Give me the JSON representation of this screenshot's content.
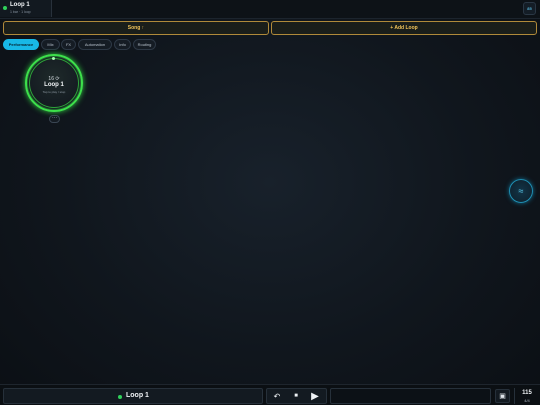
{
  "project": {
    "title": "Loop 1",
    "subtitle": "1 bar · 1 loop",
    "status_color": "#2fd15a"
  },
  "top_right_button": {
    "label": "85"
  },
  "actions": {
    "song_label": "Song ↑",
    "add_loop_label": "+ Add Loop",
    "accent_color": "#f0c35a"
  },
  "tabs": [
    {
      "label": "Performance",
      "active": true
    },
    {
      "label": "Mix",
      "active": false
    },
    {
      "label": "FX",
      "active": false
    },
    {
      "label": "Automation",
      "active": false
    },
    {
      "label": "Info",
      "active": false
    },
    {
      "label": "Routing",
      "active": false
    }
  ],
  "loop_tile": {
    "bars": "16 ⟳",
    "name": "Loop 1",
    "status": "Tap to play / stop",
    "ring_color": "#3de04b",
    "more_label": "···"
  },
  "float_button": {
    "icon": "waves-icon",
    "glyph": "≈"
  },
  "bottom_bar": {
    "now_playing": "Loop 1",
    "undo_glyph": "↶",
    "stop_glyph": "■",
    "play_glyph": "▶",
    "view_glyph": "▣",
    "tempo": "115",
    "time_signature": "4/4"
  }
}
